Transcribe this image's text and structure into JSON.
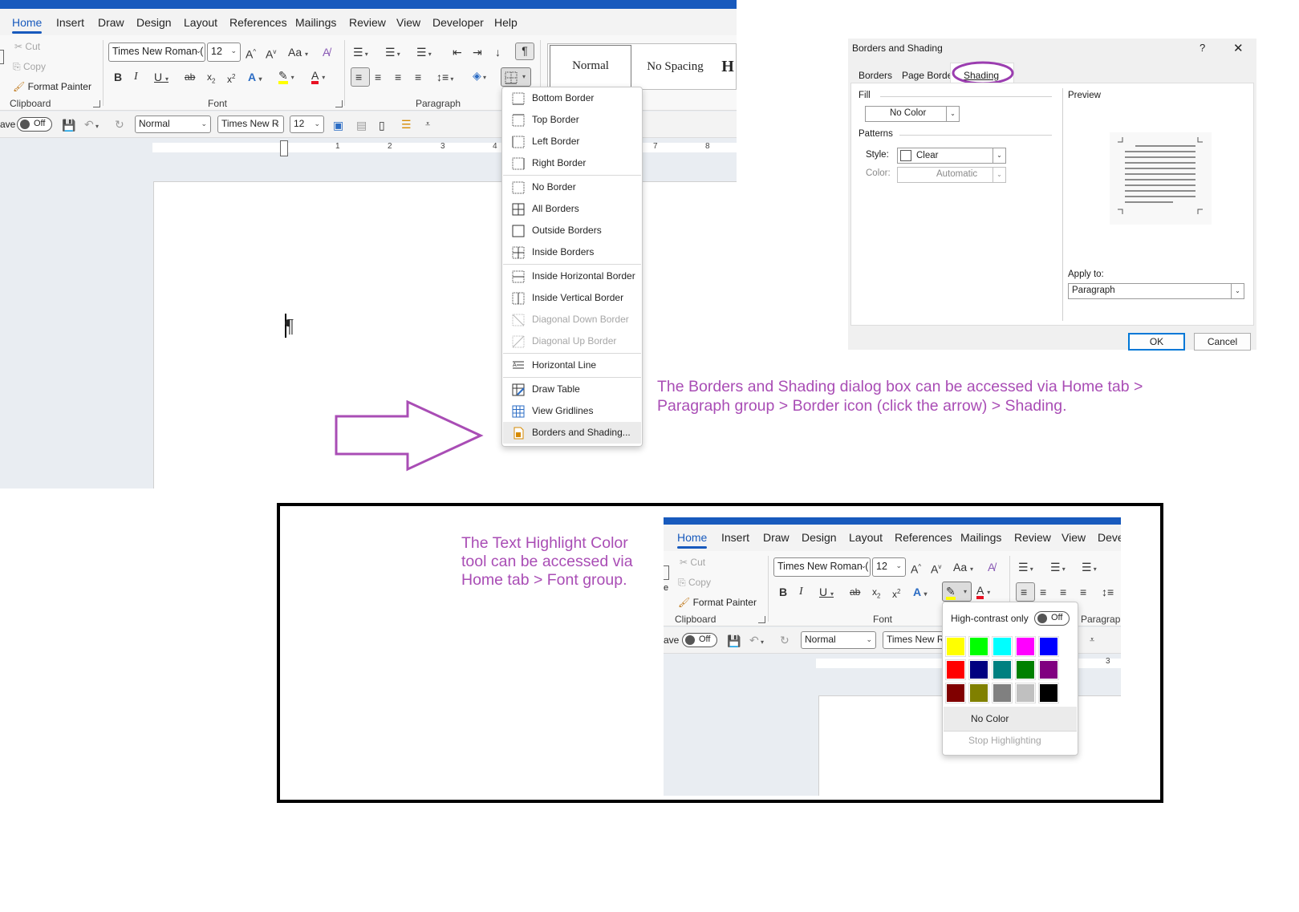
{
  "word_top": {
    "tabs": [
      "Home",
      "Insert",
      "Draw",
      "Design",
      "Layout",
      "References",
      "Mailings",
      "Review",
      "View",
      "Developer",
      "Help"
    ],
    "clipboard": {
      "cut": "Cut",
      "copy": "Copy",
      "format_painter": "Format Painter",
      "label": "Clipboard"
    },
    "font": {
      "name": "Times New Roman (",
      "size": "12",
      "label": "Font",
      "change_case": "Aa"
    },
    "paragraph_label": "Paragraph",
    "styles": [
      "Normal",
      "No Spacing",
      "H"
    ],
    "qat": {
      "autosave_prefix": "ave",
      "autosave_state": "Off",
      "style": "Normal",
      "font": "Times New R",
      "size": "12"
    },
    "ruler_numbers": [
      "1",
      "2",
      "3",
      "4",
      "7",
      "8"
    ],
    "pilcrow": "¶"
  },
  "borders_menu": {
    "items": [
      {
        "label": "Bottom Border",
        "icon": "bottom-border-icon",
        "disabled": false
      },
      {
        "label": "Top Border",
        "icon": "top-border-icon",
        "disabled": false
      },
      {
        "label": "Left Border",
        "icon": "left-border-icon",
        "disabled": false
      },
      {
        "label": "Right Border",
        "icon": "right-border-icon",
        "disabled": false
      },
      {
        "label": "No Border",
        "icon": "no-border-icon",
        "disabled": false
      },
      {
        "label": "All Borders",
        "icon": "all-borders-icon",
        "disabled": false
      },
      {
        "label": "Outside Borders",
        "icon": "outside-borders-icon",
        "disabled": false
      },
      {
        "label": "Inside Borders",
        "icon": "inside-borders-icon",
        "disabled": false
      },
      {
        "label": "Inside Horizontal Border",
        "icon": "inside-horizontal-border-icon",
        "disabled": false
      },
      {
        "label": "Inside Vertical Border",
        "icon": "inside-vertical-border-icon",
        "disabled": false
      },
      {
        "label": "Diagonal Down Border",
        "icon": "diagonal-down-border-icon",
        "disabled": true
      },
      {
        "label": "Diagonal Up Border",
        "icon": "diagonal-up-border-icon",
        "disabled": true
      },
      {
        "label": "Horizontal Line",
        "icon": "horizontal-line-icon",
        "disabled": false
      },
      {
        "label": "Draw Table",
        "icon": "draw-table-icon",
        "disabled": false
      },
      {
        "label": "View Gridlines",
        "icon": "view-gridlines-icon",
        "disabled": false
      },
      {
        "label": "Borders and Shading...",
        "icon": "borders-shading-icon",
        "disabled": false
      }
    ]
  },
  "dialog": {
    "title": "Borders and Shading",
    "help": "?",
    "close": "✕",
    "tabs": [
      "Borders",
      "Page Border",
      "Shading"
    ],
    "fill_label": "Fill",
    "fill_value": "No Color",
    "patterns_label": "Patterns",
    "style_label": "Style:",
    "style_value": "Clear",
    "color_label": "Color:",
    "color_value": "Automatic",
    "preview_label": "Preview",
    "apply_label": "Apply to:",
    "apply_value": "Paragraph",
    "ok": "OK",
    "cancel": "Cancel"
  },
  "annotations": {
    "borders": "The Borders and Shading dialog box can be accessed via Home tab > Paragraph group > Border icon (click the arrow) > Shading.",
    "highlight": "The Text Highlight Color tool can be accessed via Home tab > Font group."
  },
  "annotation_color": "#a94db5",
  "word_bottom": {
    "tabs": [
      "Home",
      "Insert",
      "Draw",
      "Design",
      "Layout",
      "References",
      "Mailings",
      "Review",
      "View",
      "Deve"
    ],
    "clipboard": {
      "cut": "Cut",
      "copy": "Copy",
      "format_painter": "Format Painter",
      "label": "Clipboard"
    },
    "font": {
      "name": "Times New Roman (",
      "size": "12",
      "label": "Font",
      "change_case": "Aa"
    },
    "paragraph_label": "Paragraph",
    "qat": {
      "autosave_prefix": "ave",
      "autosave_state": "Off",
      "style": "Normal",
      "font": "Times New R"
    },
    "ruler_number": "3"
  },
  "highlight_popup": {
    "high_contrast_label": "High-contrast only",
    "toggle_state": "Off",
    "colors": [
      "#ffff00",
      "#00ff00",
      "#00ffff",
      "#ff00ff",
      "#0000ff",
      "#ff0000",
      "#000080",
      "#008080",
      "#008000",
      "#800080",
      "#800000",
      "#808000",
      "#808080",
      "#c0c0c0",
      "#000000"
    ],
    "no_color": "No Color",
    "stop": "Stop Highlighting"
  }
}
